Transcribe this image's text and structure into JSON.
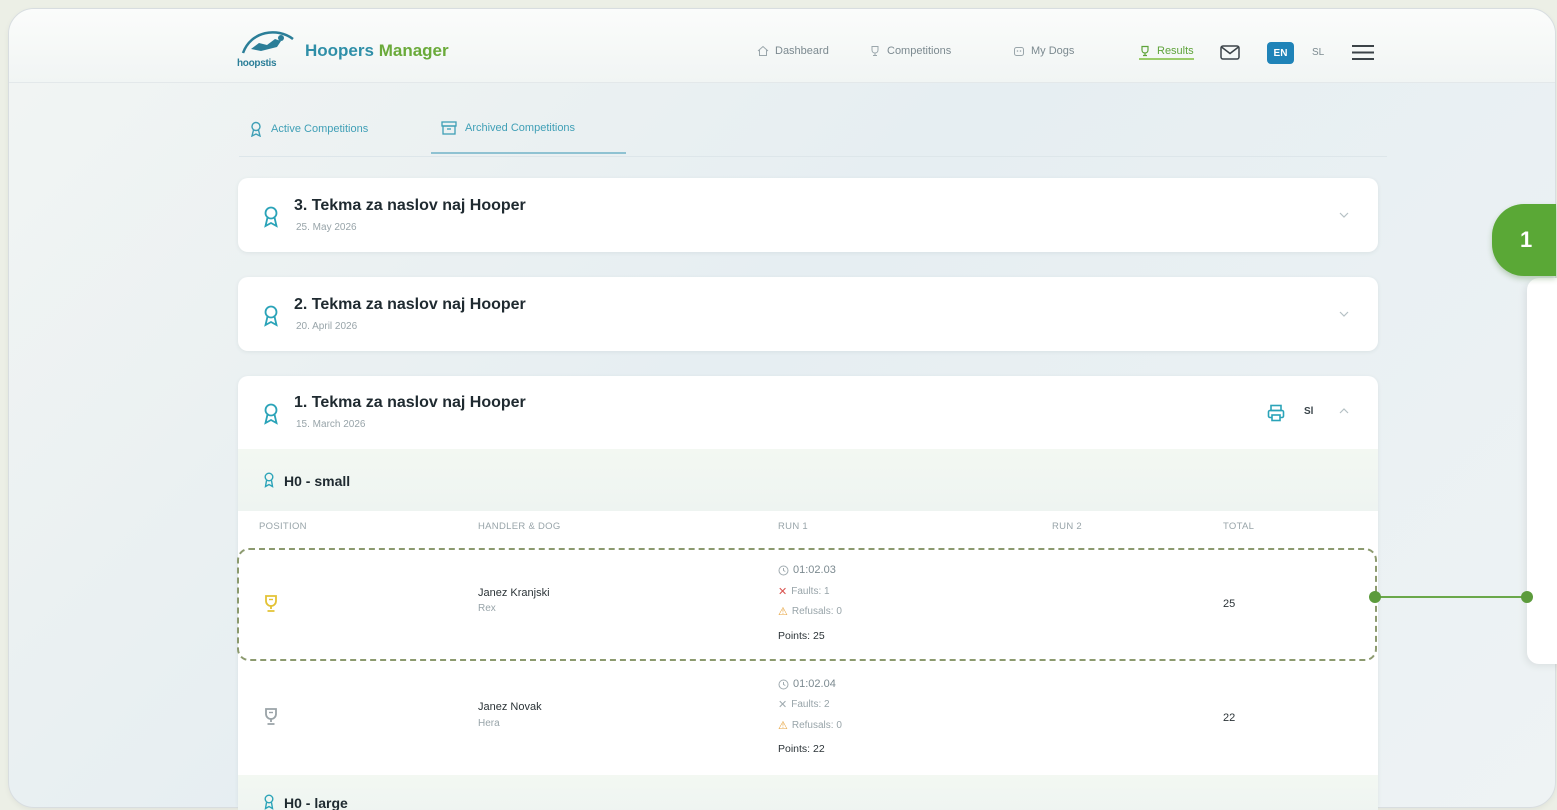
{
  "app": {
    "title_main": "Hoopers",
    "title_accent": "Manager",
    "logo_text": "hoopstis"
  },
  "nav": {
    "items": [
      {
        "label": "Dashbeard",
        "icon": "home-icon"
      },
      {
        "label": "Competitions",
        "icon": "trophy-icon"
      },
      {
        "label": "My Dogs",
        "icon": "dog-icon"
      },
      {
        "label": "Results",
        "icon": "trophy-icon",
        "active": true
      }
    ],
    "lang_en": "EN",
    "lang_sl": "SL"
  },
  "tabs": {
    "active": "Active Competitions",
    "archived": "Archived Competitions"
  },
  "competitions": [
    {
      "title": "3. Tekma za naslov naj Hooper",
      "date": "25. May 2026"
    },
    {
      "title": "2. Tekma za naslov naj Hooper",
      "date": "20. April 2026"
    },
    {
      "title": "1. Tekma za naslov naj Hooper",
      "date": "15. March 2026",
      "print_label": "Sl"
    }
  ],
  "categories": {
    "small": "H0 - small",
    "large": "H0 - large"
  },
  "columns": {
    "position": "POSITION",
    "handler": "HANDLER & DOG",
    "run1": "RUN 1",
    "run2": "RUN 2",
    "total": "TOTAL"
  },
  "results": [
    {
      "handler": "Janez Kranjski",
      "dog": "Rex",
      "time": "01:02.03",
      "faults": "Faults: 1",
      "refusals": "Refusals: 0",
      "points": "Points: 25",
      "total": "25",
      "medal_color": "#e3c234"
    },
    {
      "handler": "Janez Novak",
      "dog": "Hera",
      "time": "01:02.04",
      "faults": "Faults: 2",
      "refusals": "Refusals: 0",
      "points": "Points: 22",
      "total": "22",
      "medal_color": "#9aa3a7"
    }
  ],
  "callout": {
    "step": "1"
  },
  "colors": {
    "brand": "#2f8fa8",
    "accent_green": "#5aa836",
    "teal": "#2aa3b8"
  }
}
